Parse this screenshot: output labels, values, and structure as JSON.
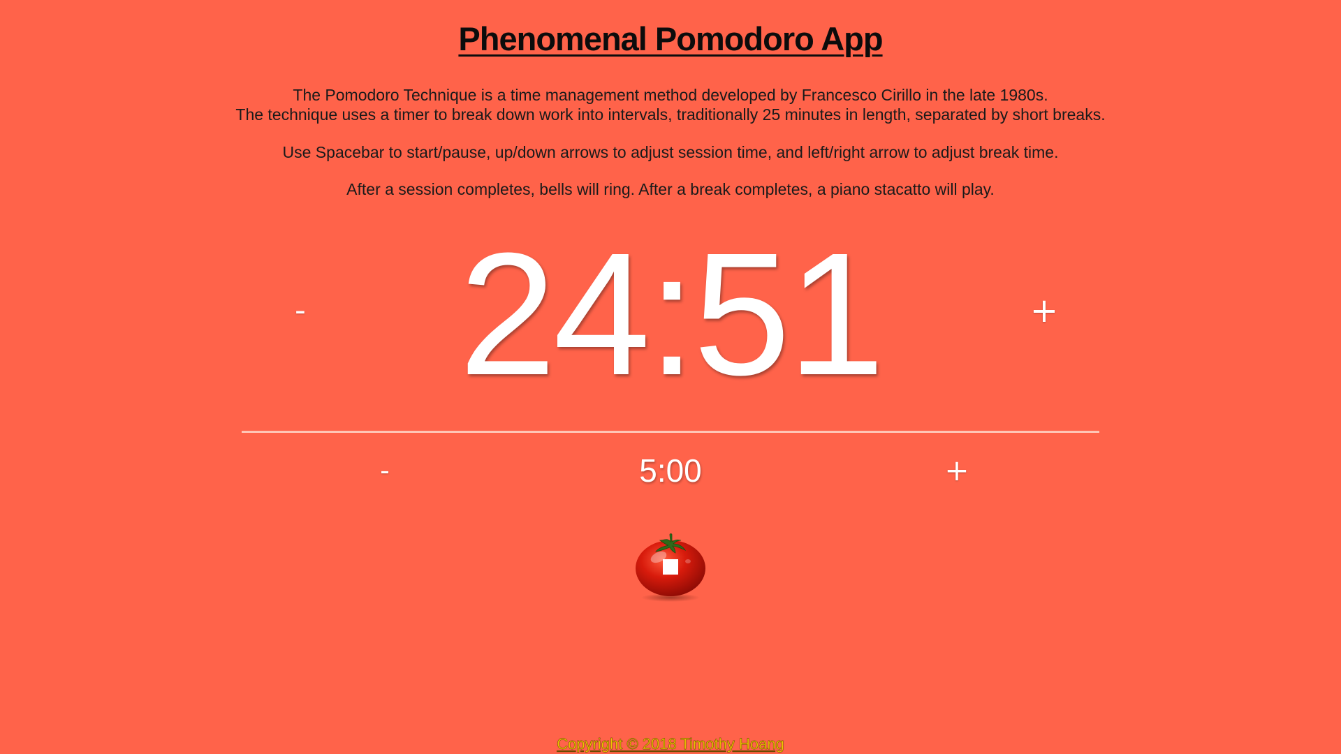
{
  "header": {
    "title": "Phenomenal Pomodoro App"
  },
  "description": {
    "line1": "The Pomodoro Technique is a time management method developed by Francesco Cirillo in the late 1980s.",
    "line2": "The technique uses a timer to break down work into intervals, traditionally 25 minutes in length, separated by short breaks.",
    "line3": "Use Spacebar to start/pause, up/down arrows to adjust session time, and left/right arrow to adjust break time.",
    "line4": "After a session completes, bells will ring. After a break completes, a piano stacatto will play."
  },
  "session": {
    "minus_label": "-",
    "time": "24:51",
    "plus_label": "+"
  },
  "break": {
    "minus_label": "-",
    "time": "5:00",
    "plus_label": "+"
  },
  "control": {
    "icon": "stop-icon",
    "button": "tomato-start-stop-button"
  },
  "footer": {
    "copyright": "Copyright © 2018 Timothy Hoang"
  },
  "colors": {
    "background": "#ff634a",
    "timer_text": "#ffffff",
    "divider": "#ffc6b6",
    "footer_link": "#f1c500",
    "tomato": "#c8140a"
  }
}
